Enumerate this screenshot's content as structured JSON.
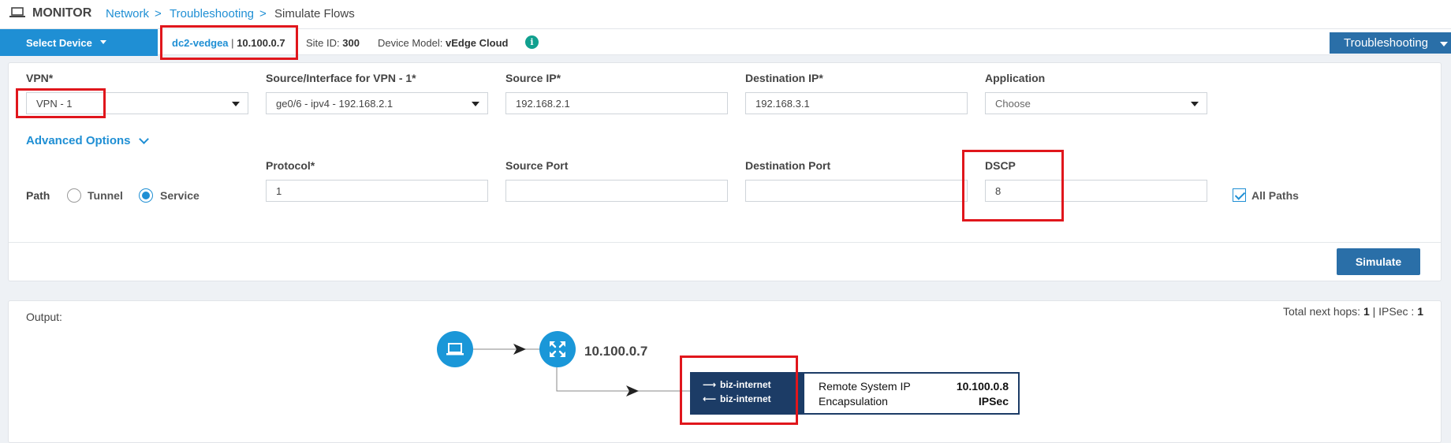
{
  "breadcrumb": {
    "section": "MONITOR",
    "items": [
      "Network",
      "Troubleshooting"
    ],
    "separator": ">",
    "current": "Simulate Flows"
  },
  "device_bar": {
    "select_device_label": "Select Device",
    "hostname": "dc2-vedgea",
    "divider": "|",
    "system_ip": "10.100.0.7",
    "site_id_label": "Site ID:",
    "site_id_value": "300",
    "device_model_label": "Device Model:",
    "device_model_value": "vEdge Cloud",
    "info_glyph": "i",
    "troubleshooting_label": "Troubleshooting"
  },
  "form": {
    "vpn": {
      "label": "VPN*",
      "value": "VPN - 1"
    },
    "source_interface": {
      "label": "Source/Interface for VPN - 1*",
      "value": "ge0/6 - ipv4 - 192.168.2.1"
    },
    "source_ip": {
      "label": "Source IP*",
      "value": "192.168.2.1"
    },
    "destination_ip": {
      "label": "Destination IP*",
      "value": "192.168.3.1"
    },
    "application": {
      "label": "Application",
      "placeholder": "Choose"
    },
    "advanced_options_label": "Advanced Options",
    "path": {
      "label": "Path",
      "options": [
        "Tunnel",
        "Service"
      ],
      "selected": "Service"
    },
    "protocol": {
      "label": "Protocol*",
      "value": "1"
    },
    "source_port": {
      "label": "Source Port",
      "value": ""
    },
    "destination_port": {
      "label": "Destination Port",
      "value": ""
    },
    "dscp": {
      "label": "DSCP",
      "value": "8"
    },
    "all_paths": {
      "label": "All Paths",
      "checked": true
    },
    "simulate_label": "Simulate"
  },
  "output": {
    "label": "Output:",
    "hops_label": "Total next hops:",
    "hops_value": "1",
    "ipsec_label": "| IPSec :",
    "ipsec_value": "1",
    "node_ip": "10.100.0.7",
    "tunnel": {
      "outgoing": "biz-internet",
      "incoming": "biz-internet",
      "remote_system_ip_label": "Remote System IP",
      "remote_system_ip_value": "10.100.0.8",
      "encapsulation_label": "Encapsulation",
      "encapsulation_value": "IPSec"
    }
  },
  "icons": {
    "monitor": "laptop-icon",
    "info": "info-icon",
    "host": "laptop-icon",
    "router": "router-icon"
  },
  "colors": {
    "accent": "#1f8fd4",
    "button": "#2a6fa8",
    "tunnel": "#1c3c66",
    "info": "#11a08f",
    "highlight": "#e0161c"
  }
}
